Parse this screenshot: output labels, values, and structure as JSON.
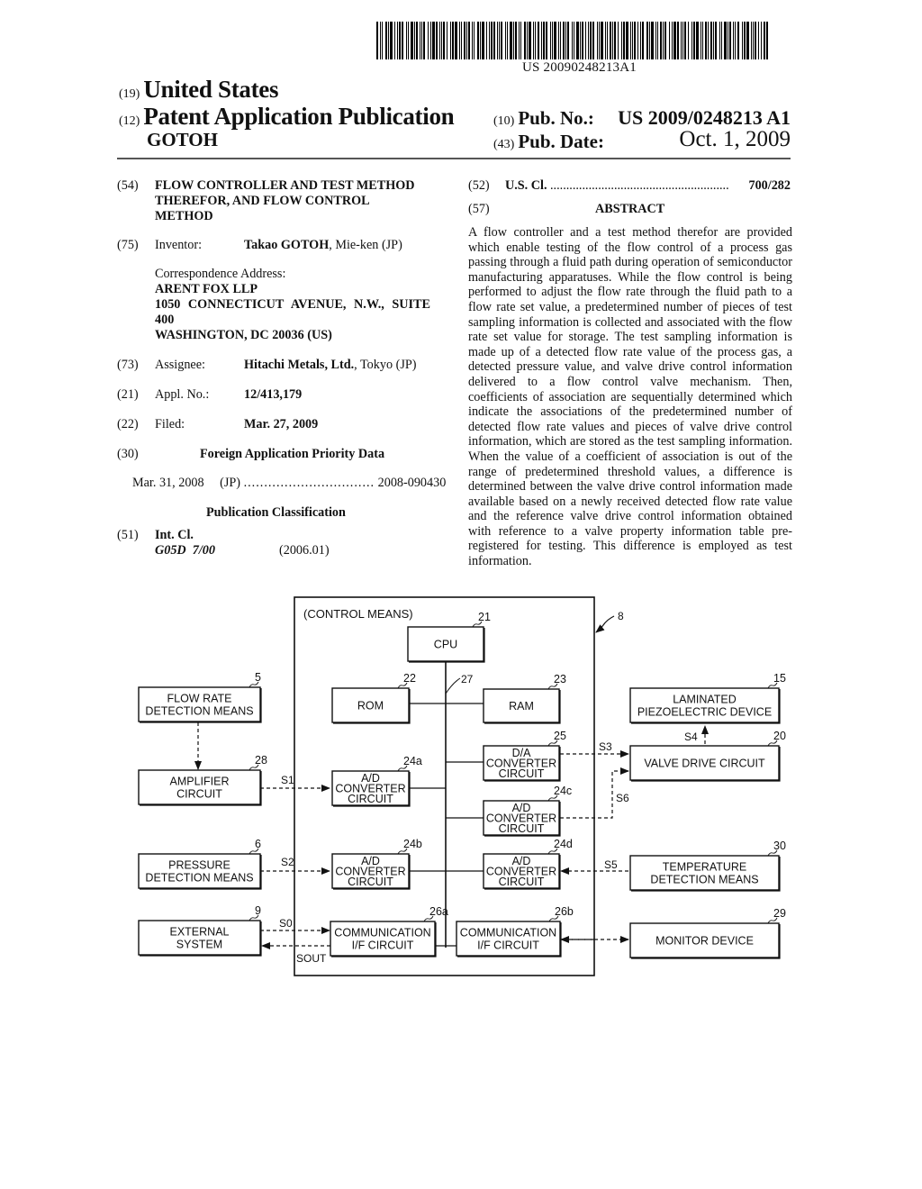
{
  "header": {
    "barcode_number": "US 20090248213A1",
    "country_code": "(19)",
    "country": "United States",
    "type_code": "(12)",
    "type": "Patent Application Publication",
    "inventor_surname": "GOTOH",
    "pub_no_code": "(10)",
    "pub_no_label": "Pub. No.:",
    "pub_no": "US 2009/0248213 A1",
    "pub_date_code": "(43)",
    "pub_date_label": "Pub. Date:",
    "pub_date": "Oct. 1, 2009"
  },
  "biblio": {
    "title_code": "(54)",
    "title_lines": [
      "FLOW CONTROLLER AND TEST METHOD",
      "THEREFOR, AND FLOW CONTROL",
      "METHOD"
    ],
    "inventor_code": "(75)",
    "inventor_label": "Inventor:",
    "inventor_name": "Takao GOTOH",
    "inventor_location": ", Mie-ken (JP)",
    "correspondence_label": "Correspondence Address:",
    "correspondence_lines": [
      "ARENT FOX LLP",
      "1050 CONNECTICUT AVENUE, N.W., SUITE",
      "400",
      "WASHINGTON, DC 20036 (US)"
    ],
    "assignee_code": "(73)",
    "assignee_label": "Assignee:",
    "assignee_name": "Hitachi Metals, Ltd.",
    "assignee_location": ", Tokyo (JP)",
    "appl_code": "(21)",
    "appl_label": "Appl. No.:",
    "appl_no": "12/413,179",
    "filed_code": "(22)",
    "filed_label": "Filed:",
    "filed_date": "Mar. 27, 2009",
    "priority_code": "(30)",
    "priority_heading": "Foreign Application Priority Data",
    "priority_date": "Mar. 31, 2008",
    "priority_country": "(JP)",
    "priority_dots": "................................",
    "priority_number": "2008-090430",
    "classification_heading": "Publication Classification",
    "int_cl_code": "(51)",
    "int_cl_label": "Int. Cl.",
    "int_cl_value": "G05D  7/00",
    "int_cl_version": "(2006.01)",
    "us_cl_code": "(52)",
    "us_cl_label": "U.S. Cl.",
    "us_cl_dots": "........................................................",
    "us_cl_value": "700/282",
    "abstract_code": "(57)",
    "abstract_heading": "ABSTRACT",
    "abstract_text": "A flow controller and a test method therefor are provided which enable testing of the flow control of a process gas passing through a fluid path during operation of semiconductor manufacturing apparatuses. While the flow control is being performed to adjust the flow rate through the fluid path to a flow rate set value, a predetermined number of pieces of test sampling information is collected and associated with the flow rate set value for storage. The test sampling information is made up of a detected flow rate value of the process gas, a detected pressure value, and valve drive control information delivered to a flow control valve mechanism. Then, coefficients of association are sequentially determined which indicate the associations of the predetermined number of detected flow rate values and pieces of valve drive control information, which are stored as the test sampling information. When the value of a coefficient of association is out of the range of predetermined threshold values, a difference is determined between the valve drive control information made available based on a newly received detected flow rate value and the reference valve drive control information obtained with reference to a valve property information table pre-registered for testing. This difference is employed as test information."
  },
  "diagram": {
    "control_label": "(CONTROL MEANS)",
    "ref_control": "8",
    "ref_bus": "27",
    "blocks": {
      "cpu": {
        "ref": "21",
        "lines": [
          "CPU"
        ]
      },
      "rom": {
        "ref": "22",
        "lines": [
          "ROM"
        ]
      },
      "ram": {
        "ref": "23",
        "lines": [
          "RAM"
        ]
      },
      "da": {
        "ref": "25",
        "lines": [
          "D/A",
          "CONVERTER",
          "CIRCUIT"
        ]
      },
      "ad_a": {
        "ref": "24a",
        "lines": [
          "A/D",
          "CONVERTER",
          "CIRCUIT"
        ]
      },
      "ad_c": {
        "ref": "24c",
        "lines": [
          "A/D",
          "CONVERTER",
          "CIRCUIT"
        ]
      },
      "ad_b": {
        "ref": "24b",
        "lines": [
          "A/D",
          "CONVERTER",
          "CIRCUIT"
        ]
      },
      "ad_d": {
        "ref": "24d",
        "lines": [
          "A/D",
          "CONVERTER",
          "CIRCUIT"
        ]
      },
      "comm_a": {
        "ref": "26a",
        "lines": [
          "COMMUNICATION",
          "I/F CIRCUIT"
        ]
      },
      "comm_b": {
        "ref": "26b",
        "lines": [
          "COMMUNICATION",
          "I/F CIRCUIT"
        ]
      },
      "flow": {
        "ref": "5",
        "lines": [
          "FLOW RATE",
          "DETECTION MEANS"
        ]
      },
      "amp": {
        "ref": "28",
        "lines": [
          "AMPLIFIER",
          "CIRCUIT"
        ]
      },
      "pressure": {
        "ref": "6",
        "lines": [
          "PRESSURE",
          "DETECTION MEANS"
        ]
      },
      "external": {
        "ref": "9",
        "lines": [
          "EXTERNAL",
          "SYSTEM"
        ]
      },
      "piezo": {
        "ref": "15",
        "lines": [
          "LAMINATED",
          "PIEZOELECTRIC DEVICE"
        ]
      },
      "valve": {
        "ref": "20",
        "lines": [
          "VALVE DRIVE CIRCUIT"
        ]
      },
      "temp": {
        "ref": "30",
        "lines": [
          "TEMPERATURE",
          "DETECTION MEANS"
        ]
      },
      "monitor": {
        "ref": "29",
        "lines": [
          "MONITOR DEVICE"
        ]
      }
    },
    "signals": {
      "s0": "S0",
      "s1": "S1",
      "s2": "S2",
      "s3": "S3",
      "s4": "S4",
      "s5": "S5",
      "s6": "S6",
      "sout": "SOUT"
    }
  }
}
